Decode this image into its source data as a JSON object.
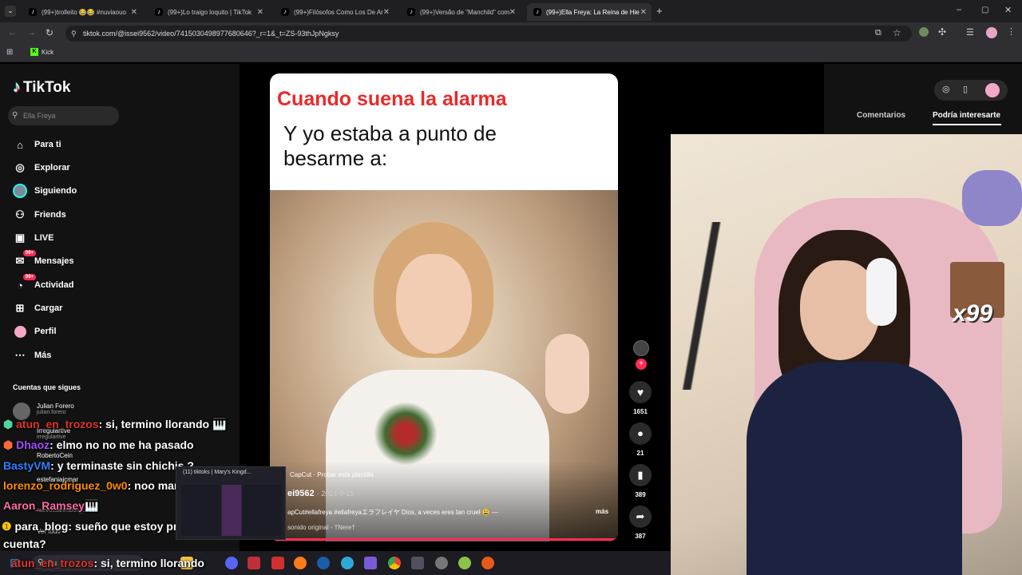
{
  "browser": {
    "tabs": [
      {
        "title": "(99+)trolleito 😂😂 #nuviaouo"
      },
      {
        "title": "(99+)Lo traigo loquito | TikTok"
      },
      {
        "title": "(99+)Filósofos Como Los De Ar"
      },
      {
        "title": "(99+)Versão de \"Manchild\" com"
      },
      {
        "title": "(99+)Ella Freya: La Reina de Hie"
      }
    ],
    "url": "tiktok.com/@issei9562/video/7415030498977680646?_r=1&_t=ZS-93thJpNgksy",
    "bookmark": "Kick"
  },
  "tiktok": {
    "logo": "TikTok",
    "search_placeholder": "Ella Freya",
    "nav": [
      {
        "label": "Para ti",
        "icon": "home-icon"
      },
      {
        "label": "Explorar",
        "icon": "compass-icon"
      },
      {
        "label": "Siguiendo",
        "icon": "avatar-icon"
      },
      {
        "label": "Friends",
        "icon": "friends-icon"
      },
      {
        "label": "LIVE",
        "icon": "live-icon"
      },
      {
        "label": "Mensajes",
        "icon": "message-icon",
        "badge": "99+"
      },
      {
        "label": "Actividad",
        "icon": "bell-icon",
        "badge": "99+"
      },
      {
        "label": "Cargar",
        "icon": "upload-icon"
      },
      {
        "label": "Perfil",
        "icon": "profile-icon"
      },
      {
        "label": "Más",
        "icon": "more-icon"
      }
    ],
    "following_header": "Cuentas que sigues",
    "accounts": [
      {
        "name": "Julian Forero",
        "handle": "julian.forero"
      },
      {
        "name": "Irregulartive",
        "handle": "irregulartive"
      },
      {
        "name": "RobertoCein",
        "handle": ""
      },
      {
        "name": "estefaniajcmar",
        "handle": ""
      },
      {
        "name": "nuevossanmartin_cor",
        "handle": ""
      }
    ],
    "see_all": "Ver todo",
    "video": {
      "caption_red": "Cuando suena la alarma",
      "caption_black": "Y yo estaba a punto de besarme a:",
      "capcut": "CapCut · Probar esta plantilla",
      "author": "ei9562",
      "date": "2024-9-15",
      "description": "apCut#ellafreya  #ellafreyaエラフレイヤ Dios, a veces eres tan cruel 😩 —",
      "more": "más",
      "sound": "sonido original - †Nere†"
    },
    "actions": [
      {
        "icon": "heart-icon",
        "count": "1651"
      },
      {
        "icon": "comment-icon",
        "count": "21"
      },
      {
        "icon": "bookmark-icon",
        "count": "389"
      },
      {
        "icon": "share-icon",
        "count": "387"
      }
    ],
    "right_tabs": [
      "Comentarios",
      "Podría interesarte"
    ]
  },
  "chat": [
    {
      "user": "atun_en_trozos",
      "color": "#e0352b",
      "text": ": si, termino llorando 🎹"
    },
    {
      "user": "Dhaoz",
      "color": "#a64dff",
      "text": ": elmo no no me ha pasado"
    },
    {
      "user": "BastyVM",
      "color": "#2f7fff",
      "text": ": y terminaste sin chichis ?"
    },
    {
      "user": "lorenzo_rodriguez_0w0",
      "color": "#ff8c00",
      "text": ": noo mary"
    },
    {
      "user": "Aaron_Ramsey",
      "color": "#ff6aa8",
      "text": "🎹"
    },
    {
      "user": "para_blog",
      "color": "#ffffff",
      "text": ": sueño que estoy programando,"
    },
    {
      "user": "",
      "color": "#ffffff",
      "text": "cuenta?"
    },
    {
      "user": "atun_en_trozos",
      "color": "#e0352b",
      "text": ": si, termino llorando"
    }
  ],
  "overlay": {
    "x99": "x99",
    "preview_title": "(11) tiktoks | Mary's Kingd..."
  },
  "taskbar": {
    "search": "Bu"
  }
}
